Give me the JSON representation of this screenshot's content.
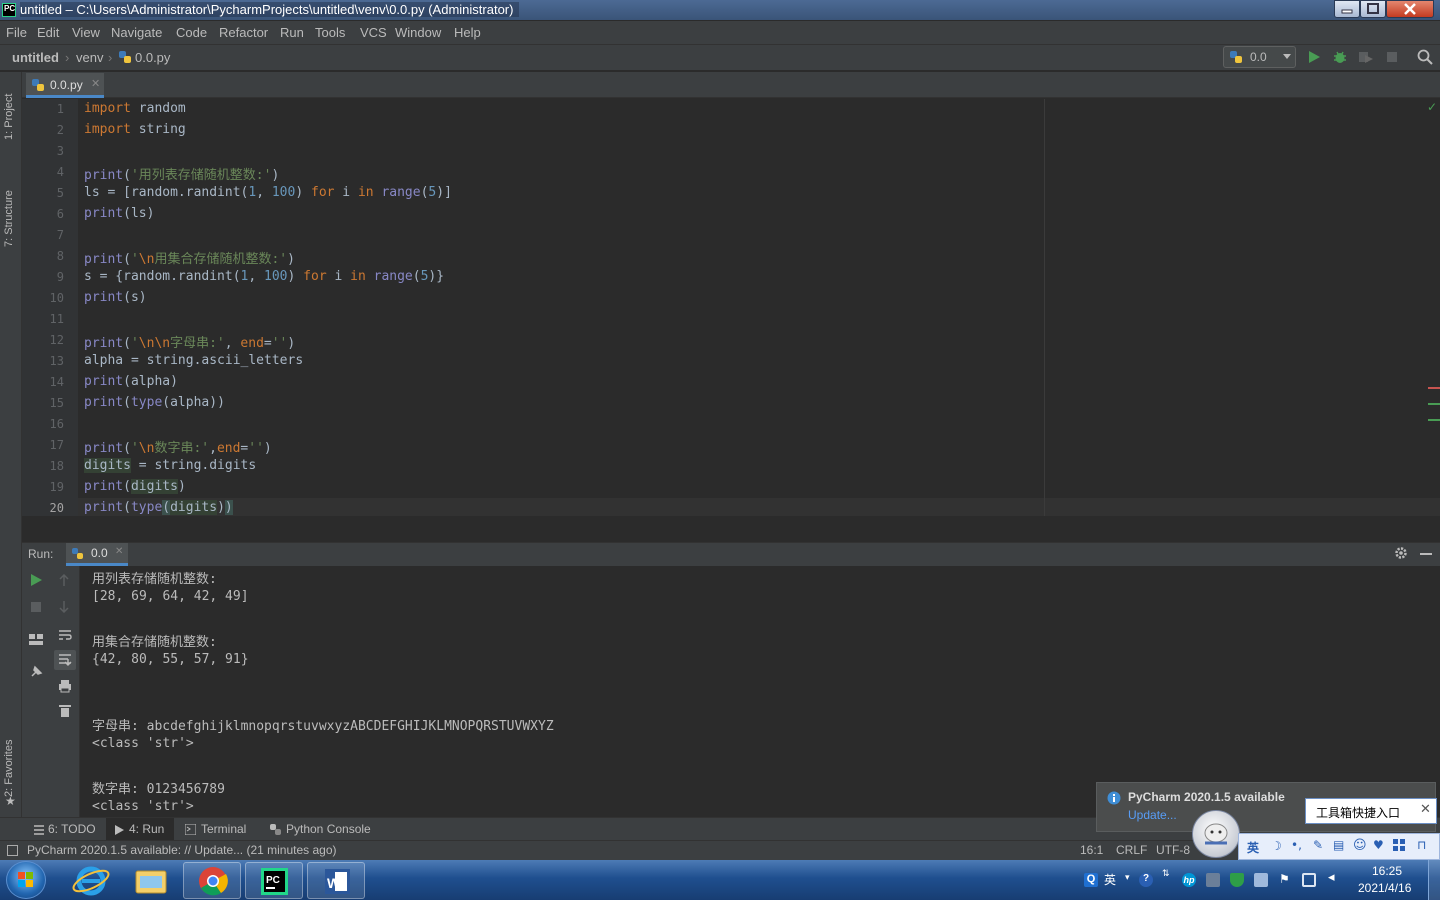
{
  "window": {
    "title": "untitled – C:\\Users\\Administrator\\PycharmProjects\\untitled\\venv\\0.0.py (Administrator)",
    "logo_text": "PC"
  },
  "menu": [
    {
      "label": "File"
    },
    {
      "label": "Edit"
    },
    {
      "label": "View"
    },
    {
      "label": "Navigate"
    },
    {
      "label": "Code"
    },
    {
      "label": "Refactor"
    },
    {
      "label": "Run"
    },
    {
      "label": "Tools"
    },
    {
      "label": "VCS"
    },
    {
      "label": "Window"
    },
    {
      "label": "Help"
    }
  ],
  "breadcrumbs": {
    "project": "untitled",
    "folder": "venv",
    "file": "0.0.py"
  },
  "run_config": {
    "name": "0.0"
  },
  "side_tabs": {
    "project": "1: Project",
    "structure": "7: Structure",
    "favorites": "2: Favorites"
  },
  "editor_tab": {
    "label": "0.0.py"
  },
  "editor": {
    "line_numbers": [
      "1",
      "2",
      "3",
      "4",
      "5",
      "6",
      "7",
      "8",
      "9",
      "10",
      "11",
      "12",
      "13",
      "14",
      "15",
      "16",
      "17",
      "18",
      "19",
      "20"
    ],
    "current_line": "20"
  },
  "run_panel": {
    "label": "Run:",
    "tab": "0.0"
  },
  "console": {
    "lines": [
      "用列表存储随机整数:",
      "[28, 69, 64, 42, 49]",
      "",
      "用集合存储随机整数:",
      "{42, 80, 55, 57, 91}",
      "",
      "",
      "字母串: abcdefghijklmnopqrstuvwxyzABCDEFGHIJKLMNOPQRSTUVWXYZ",
      "<class 'str'>",
      "",
      "数字串: 0123456789",
      "<class 'str'>"
    ]
  },
  "bottom_tabs": [
    {
      "label": "6: TODO"
    },
    {
      "label": "4: Run"
    },
    {
      "label": "Terminal"
    },
    {
      "label": "Python Console"
    }
  ],
  "status": {
    "message": "PyCharm 2020.1.5 available: // Update... (21 minutes ago)",
    "position": "16:1",
    "line_sep": "CRLF",
    "encoding": "UTF-8"
  },
  "notification": {
    "title": "PyCharm 2020.1.5 available",
    "link": "Update..."
  },
  "ime": {
    "tooltip": "工具箱快捷入口",
    "lang": "英"
  },
  "taskbar": {
    "time": "16:25",
    "date": "2021/4/16",
    "tray_lang": "英"
  },
  "colors": {
    "keyword": "#cc7832",
    "string": "#6a8759",
    "number": "#6897bb",
    "builtin": "#8888c6",
    "text": "#a9b7c6",
    "accent": "#4a88c7"
  }
}
